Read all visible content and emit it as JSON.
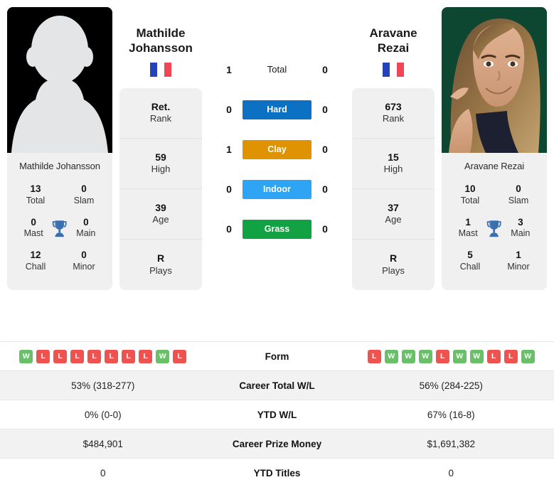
{
  "players": {
    "left": {
      "first_name": "Mathilde",
      "last_name": "Johansson",
      "full_name": "Mathilde Johansson",
      "country": "France",
      "flag": "fr-flag-icon",
      "photo": "player-silhouette-photo",
      "info": [
        {
          "value": "Ret.",
          "label": "Rank"
        },
        {
          "value": "59",
          "label": "High"
        },
        {
          "value": "39",
          "label": "Age"
        },
        {
          "value": "R",
          "label": "Plays"
        }
      ],
      "titles": {
        "total": "13",
        "slam": "0",
        "mast": "0",
        "main": "0",
        "chall": "12",
        "minor": "0"
      },
      "form": [
        "W",
        "L",
        "L",
        "L",
        "L",
        "L",
        "L",
        "L",
        "W",
        "L"
      ],
      "career_total_wl": "53% (318-277)",
      "ytd_wl": "0% (0-0)",
      "career_prize_money": "$484,901",
      "ytd_titles": "0"
    },
    "right": {
      "first_name": "Aravane",
      "last_name": "Rezai",
      "full_name": "Aravane Rezai",
      "country": "France",
      "flag": "fr-flag-icon",
      "photo": "player-portrait-photo",
      "info": [
        {
          "value": "673",
          "label": "Rank"
        },
        {
          "value": "15",
          "label": "High"
        },
        {
          "value": "37",
          "label": "Age"
        },
        {
          "value": "R",
          "label": "Plays"
        }
      ],
      "titles": {
        "total": "10",
        "slam": "0",
        "mast": "1",
        "main": "3",
        "chall": "5",
        "minor": "1"
      },
      "form": [
        "L",
        "W",
        "W",
        "W",
        "L",
        "W",
        "W",
        "L",
        "L",
        "W"
      ],
      "career_total_wl": "56% (284-225)",
      "ytd_wl": "67% (16-8)",
      "career_prize_money": "$1,691,382",
      "ytd_titles": "0"
    }
  },
  "titles_labels": {
    "total": "Total",
    "slam": "Slam",
    "mast": "Mast",
    "main": "Main",
    "chall": "Chall",
    "minor": "Minor"
  },
  "head_to_head": {
    "rows": [
      {
        "surface": "Total",
        "left": "1",
        "right": "0",
        "color": "transparent"
      },
      {
        "surface": "Hard",
        "left": "0",
        "right": "0",
        "color": "#0c71c3"
      },
      {
        "surface": "Clay",
        "left": "1",
        "right": "0",
        "color": "#e09302"
      },
      {
        "surface": "Indoor",
        "left": "0",
        "right": "0",
        "color": "#2fa4f5"
      },
      {
        "surface": "Grass",
        "left": "0",
        "right": "0",
        "color": "#12a244"
      }
    ]
  },
  "stats_table": {
    "rows": [
      {
        "label": "Form"
      },
      {
        "label": "Career Total W/L"
      },
      {
        "label": "YTD W/L"
      },
      {
        "label": "Career Prize Money"
      },
      {
        "label": "YTD Titles"
      }
    ]
  },
  "colors": {
    "win_badge": "#6abf69",
    "loss_badge": "#ef5350",
    "trophy": "#3b6fb0",
    "flag_blue": "#2443b8",
    "flag_white": "#ffffff",
    "flag_red": "#f04658",
    "card_bg": "#f0f0f0",
    "row_shade": "#f2f2f2"
  }
}
